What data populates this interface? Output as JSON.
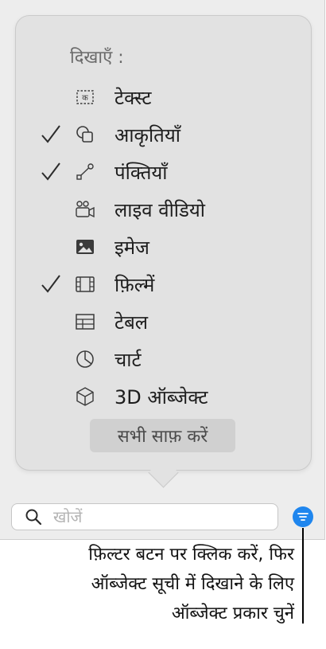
{
  "popover": {
    "show_label": "दिखाएँ :",
    "items": [
      {
        "label": "टेक्स्ट",
        "icon": "text-box-icon",
        "checked": false
      },
      {
        "label": "आकृतियाँ",
        "icon": "shapes-icon",
        "checked": true
      },
      {
        "label": "पंक्तियाँ",
        "icon": "lines-icon",
        "checked": true
      },
      {
        "label": "लाइव वीडियो",
        "icon": "live-video-icon",
        "checked": false
      },
      {
        "label": "इमेज",
        "icon": "image-icon",
        "checked": false
      },
      {
        "label": "फ़िल्में",
        "icon": "film-icon",
        "checked": true
      },
      {
        "label": "टेबल",
        "icon": "table-icon",
        "checked": false
      },
      {
        "label": "चार्ट",
        "icon": "chart-icon",
        "checked": false
      },
      {
        "label": "3D ऑब्जेक्ट",
        "icon": "3d-object-icon",
        "checked": false
      }
    ],
    "clear_all_label": "सभी साफ़ करें"
  },
  "search": {
    "placeholder": "खोजें",
    "value": ""
  },
  "filter_button": {
    "icon": "filter-icon",
    "color": "#1f86ee"
  },
  "caption": {
    "line1": "फ़िल्टर बटन पर क्लिक करें, फिर",
    "line2": "ऑब्जेक्ट सूची में दिखाने के लिए",
    "line3": "ऑब्जेक्ट प्रकार चुनें"
  }
}
